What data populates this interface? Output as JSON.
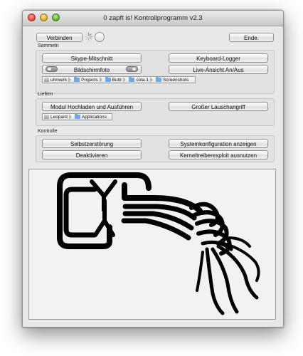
{
  "window": {
    "title": "0 zapft is! Kontrollprogramm v2.3"
  },
  "toolbar": {
    "connect_label": "Verbinden",
    "quit_label": "Ende."
  },
  "sammeln": {
    "label": "Sammeln",
    "skype_label": "Skype-Mitschnitt",
    "keylogger_label": "Keyboard-Logger",
    "screenshot_label": "Bildschirmfoto",
    "live_label": "Live-Ansicht An/Aus",
    "path": [
      "uhrwerk",
      "Projects",
      "Buttr",
      "cola-1",
      "Screenshots"
    ]
  },
  "liefern": {
    "label": "Liefern",
    "upload_label": "Modul Hochladen und Ausführen",
    "eavesdrop_label": "Großer Lauschangriff",
    "path": [
      "Leopard",
      "Applications"
    ]
  },
  "kontrolle": {
    "label": "Kontrolle",
    "selfdestruct_label": "Selbstzerstörung",
    "sysconfig_label": "Systemkonfiguration anzeigen",
    "deactivate_label": "Deaktivieren",
    "kernel_label": "Kerneltreiberexploit ausnutzen"
  },
  "icons": [
    "close-icon",
    "minimize-icon",
    "zoom-icon",
    "spinner-icon",
    "toggle-icon",
    "folder-icon",
    "disk-icon"
  ],
  "colors": {
    "window_bg": "#e8e8e8",
    "folder": "#6fa8e6",
    "logo": "#000000"
  }
}
